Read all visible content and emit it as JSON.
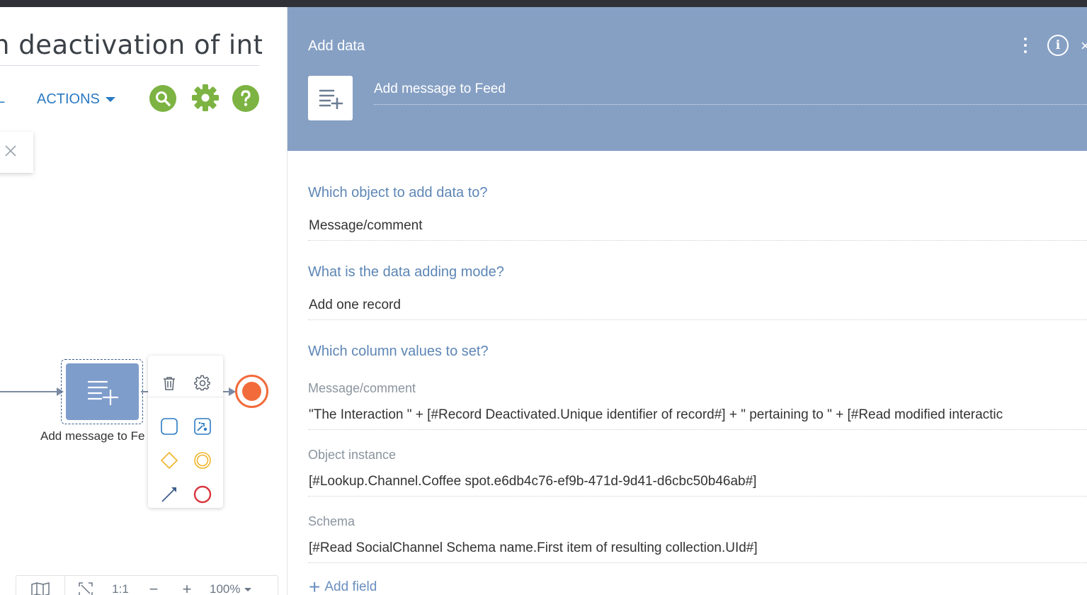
{
  "designer": {
    "process_title": "n deactivation of inter",
    "toolbar_fragment": "L",
    "actions_label": "ACTIONS",
    "task_label": "Add message to Fe",
    "zoom": {
      "one_to_one": "1:1",
      "minus": "−",
      "plus": "+",
      "level": "100%"
    }
  },
  "panel": {
    "title": "Add data",
    "element_name": "Add message to Feed",
    "questions": [
      {
        "label": "Which object to add data to?",
        "value": "Message/comment"
      },
      {
        "label": "What is the data adding mode?",
        "value": "Add one record"
      },
      {
        "label": "Which column values to set?"
      }
    ],
    "fields": [
      {
        "label": "Message/comment",
        "value": "\"The Interaction \" + [#Record Deactivated.Unique identifier of record#] + \" pertaining to \" + [#Read modified interactic"
      },
      {
        "label": "Object instance",
        "value": "[#Lookup.Channel.Coffee spot.e6db4c76-ef9b-471d-9d41-d6cbc50b46ab#]"
      },
      {
        "label": "Schema",
        "value": "[#Read SocialChannel Schema name.First item of resulting collection.UId#]"
      }
    ],
    "add_field_label": "Add field"
  },
  "colors": {
    "header_bg": "#86a0c4",
    "link_blue": "#2b7ac2",
    "question_blue": "#5d86b6",
    "icon_green": "#7cb342",
    "end_event_orange": "#f26b3a",
    "task_blue": "#7f9dcb"
  },
  "icons": [
    "search-icon",
    "gear-icon",
    "help-icon",
    "kebab-menu-icon",
    "info-icon",
    "close-icon",
    "add-data-icon",
    "trash-icon",
    "settings-icon",
    "task-icon",
    "script-task-icon",
    "gateway-icon",
    "intermediate-event-icon",
    "connector-icon",
    "end-event-icon",
    "map-icon",
    "fit-icon"
  ]
}
